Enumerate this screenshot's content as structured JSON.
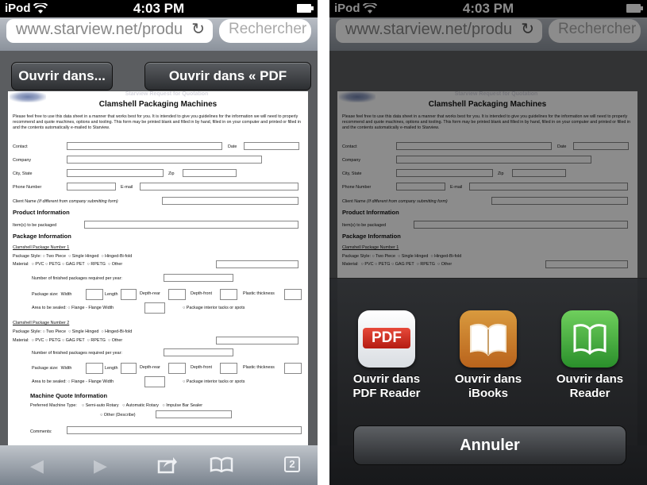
{
  "status_bar": {
    "carrier": "iPod",
    "time": "4:03 PM"
  },
  "browser": {
    "url": "www.starview.net/produ",
    "search_placeholder": "Rechercher",
    "open_in_label": "Ouvrir dans...",
    "open_in_pdf_label": "Ouvrir dans « PDF Reader »"
  },
  "document": {
    "subtitle": "Starview Request for Quotation",
    "title": "Clamshell Packaging Machines",
    "intro": "Please feel free to use this data sheet in a manner that works best for you. It is intended to give you guidelines for the information we will need to properly recommend and quote machines, options and tooling. This form may be printed blank and filled in by hand, filled in on your computer and printed or filled in and the contents automatically e-mailed to Starview.",
    "fields": {
      "contact": "Contact",
      "date": "Date",
      "company": "Company",
      "city_state": "City, State",
      "zip": "Zip",
      "phone": "Phone Number",
      "email": "E-mail",
      "client_name": "Client Name",
      "client_note": "(If different from company submitting form)"
    },
    "product_info": {
      "heading": "Product Information",
      "items_label": "Item(s) to be packaged"
    },
    "package_info": {
      "heading": "Package Information",
      "pkg1_title": "Clamshell Package Number 1",
      "pkg2_title": "Clamshell Package Number 2",
      "style_label": "Package Style:",
      "style_opts": [
        "Two Piece",
        "Single Hinged",
        "Hinged-Bi-fold"
      ],
      "material_label": "Material:",
      "material_opts": [
        "PVC",
        "PETG",
        "GAG PET",
        "RPETG",
        "Other"
      ],
      "num_finished": "Number of finished packages required per year:",
      "size_label": "Package size:",
      "size_opts": [
        "Width",
        "Length",
        "Depth-rear",
        "Depth-front",
        "Plastic thickness"
      ],
      "sealed_label": "Area to be sealed:",
      "sealed_opts": [
        "Flange -",
        "Flange Width",
        "Package interior tacks or spots"
      ]
    },
    "machine_quote": {
      "heading": "Machine Quote Information",
      "preferred_label": "Preferred Machine Type:",
      "opts": [
        "Semi-auto Rotary",
        "Automatic Rotary",
        "Impulse Bar Sealer",
        "Other (Describe)"
      ],
      "comments_label": "Comments:"
    }
  },
  "bottom_bar": {
    "tabs_count": "2"
  },
  "share_sheet": {
    "apps": [
      {
        "name": "Ouvrir dans PDF Reader",
        "icon_text": "PDF"
      },
      {
        "name": "Ouvrir dans iBooks"
      },
      {
        "name": "Ouvrir dans Reader"
      }
    ],
    "cancel_label": "Annuler"
  }
}
